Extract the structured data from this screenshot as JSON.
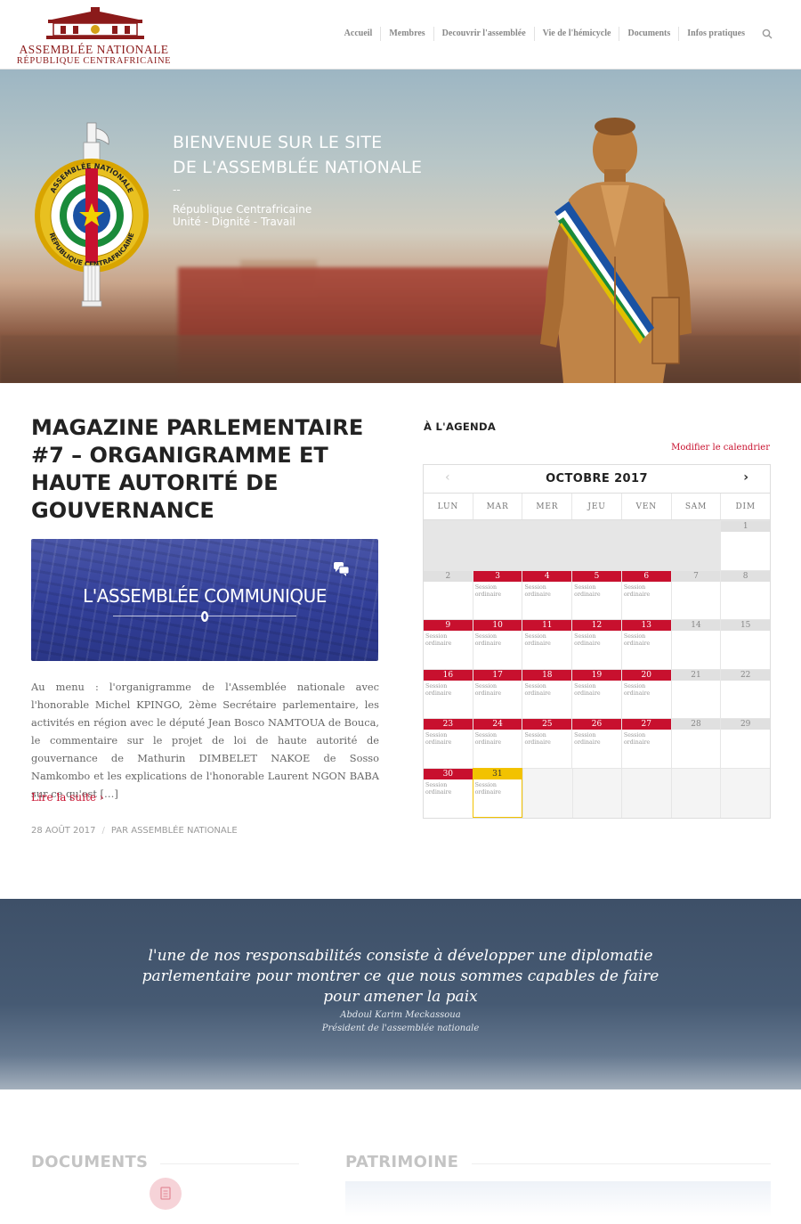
{
  "header": {
    "logo_line1": "ASSEMBLÉE NATIONALE",
    "logo_line2": "RÉPUBLIQUE CENTRAFRICAINE",
    "nav": [
      "Accueil",
      "Membres",
      "Decouvrir l'assemblée",
      "Vie de l'hémicycle",
      "Documents",
      "Infos pratiques"
    ],
    "search_icon": "search-icon"
  },
  "hero": {
    "title_line1": "BIENVENUE SUR LE SITE",
    "title_line2": "DE L'ASSEMBLÉE NATIONALE",
    "dash": "--",
    "sub_line1": "République Centrafricaine",
    "sub_line2": "Unité - Dignité - Travail",
    "emblem_top": "ASSEMBLÉE NATIONALE",
    "emblem_bottom": "RÉPUBLIQUE CENTRAFRICAINE"
  },
  "article": {
    "title": "MAGAZINE PARLEMENTAIRE #7 – ORGANIGRAMME ET HAUTE AUTORITÉ DE GOUVERNANCE",
    "banner_text": "L'ASSEMBLÉE COMMUNIQUE",
    "excerpt": "Au menu : l'organigramme de l'Assemblée nationale avec l'honorable Michel KPINGO, 2ème Secrétaire parlementaire, les activités en région avec le député Jean Bosco NAMTOUA de Bouca, le commentaire sur le projet de loi de haute autorité de gouvernance de Mathurin DIMBELET NAKOE de Sosso Namkombo et les explications de l'honorable Laurent NGON BABA  sur ce qu'est […]",
    "read_more": "Lire la suite",
    "read_more_arrow": "›",
    "date": "28 AOÛT 2017",
    "meta_sep": "/",
    "author": "PAR ASSEMBLÉE NATIONALE",
    "chat_icon": "chat-bubbles-icon"
  },
  "agenda": {
    "title": "À L'AGENDA",
    "edit_link": "Modifier le calendrier",
    "month": "OCTOBRE 2017",
    "prev": "‹",
    "next": "›",
    "weekdays": [
      "LUN",
      "MAR",
      "MER",
      "JEU",
      "VEN",
      "SAM",
      "DIM"
    ],
    "event_label": "Session ordinaire",
    "event_color": "#c8102e",
    "today_color": "#f2c200",
    "weeks": [
      [
        null,
        null,
        null,
        null,
        null,
        null,
        {
          "d": "1"
        }
      ],
      [
        {
          "d": "2"
        },
        {
          "d": "3",
          "ev": true
        },
        {
          "d": "4",
          "ev": true
        },
        {
          "d": "5",
          "ev": true
        },
        {
          "d": "6",
          "ev": true
        },
        {
          "d": "7"
        },
        {
          "d": "8"
        }
      ],
      [
        {
          "d": "9",
          "ev": true
        },
        {
          "d": "10",
          "ev": true
        },
        {
          "d": "11",
          "ev": true
        },
        {
          "d": "12",
          "ev": true
        },
        {
          "d": "13",
          "ev": true
        },
        {
          "d": "14"
        },
        {
          "d": "15"
        }
      ],
      [
        {
          "d": "16",
          "ev": true
        },
        {
          "d": "17",
          "ev": true
        },
        {
          "d": "18",
          "ev": true
        },
        {
          "d": "19",
          "ev": true
        },
        {
          "d": "20",
          "ev": true
        },
        {
          "d": "21"
        },
        {
          "d": "22"
        }
      ],
      [
        {
          "d": "23",
          "ev": true
        },
        {
          "d": "24",
          "ev": true
        },
        {
          "d": "25",
          "ev": true
        },
        {
          "d": "26",
          "ev": true
        },
        {
          "d": "27",
          "ev": true
        },
        {
          "d": "28"
        },
        {
          "d": "29"
        }
      ],
      [
        {
          "d": "30",
          "ev": true
        },
        {
          "d": "31",
          "ev": true,
          "today": true
        },
        "blank",
        "blank",
        "blank",
        "blank",
        "blank"
      ]
    ]
  },
  "quote": {
    "text": "l'une de nos responsabilités consiste à développer une diplomatie parlementaire pour montrer ce que nous sommes capables de faire pour amener la paix",
    "author": "Abdoul Karim Meckassoua",
    "role": "Président de l'assemblée nationale"
  },
  "bottom": {
    "documents": "DOCUMENTS",
    "patrimoine": "PATRIMOINE",
    "doc_icon": "document-icon"
  }
}
